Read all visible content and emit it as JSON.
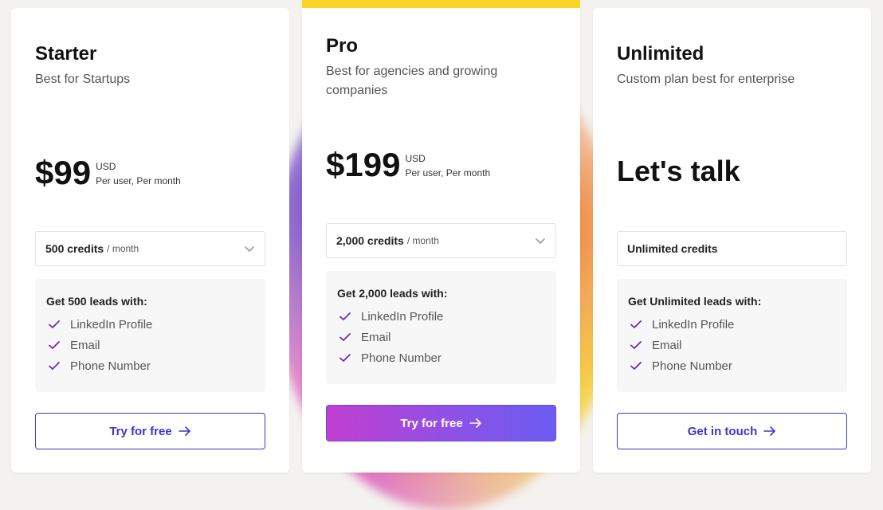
{
  "colors": {
    "accent": "#3b37c9",
    "featured_top": "#fbd42a",
    "check": "#6a2bb5",
    "gradient_start": "#c23ed0",
    "gradient_end": "#6b5cf0"
  },
  "plans": [
    {
      "name": "Starter",
      "description": "Best for Startups",
      "price": "$99",
      "currency": "USD",
      "period": "Per user, Per month",
      "credits_value": "500 credits",
      "credits_unit": "/ month",
      "features_title": "Get 500 leads with:",
      "features": [
        "LinkedIn Profile",
        "Email",
        "Phone Number"
      ],
      "cta": "Try for free",
      "icons": {
        "check": "check-icon",
        "arrow": "arrow-right-icon",
        "chevron": "chevron-down-icon"
      }
    },
    {
      "name": "Pro",
      "description": "Best for agencies and growing companies",
      "price": "$199",
      "currency": "USD",
      "period": "Per user, Per month",
      "credits_value": "2,000 credits",
      "credits_unit": "/ month",
      "features_title": "Get 2,000 leads with:",
      "features": [
        "LinkedIn Profile",
        "Email",
        "Phone Number"
      ],
      "cta": "Try for free"
    },
    {
      "name": "Unlimited",
      "description": "Custom plan best for enterprise",
      "price_text": "Let's talk",
      "credits_value": "Unlimited credits",
      "features_title": "Get Unlimited leads with:",
      "features": [
        "LinkedIn Profile",
        "Email",
        "Phone Number"
      ],
      "cta": "Get in touch"
    }
  ]
}
